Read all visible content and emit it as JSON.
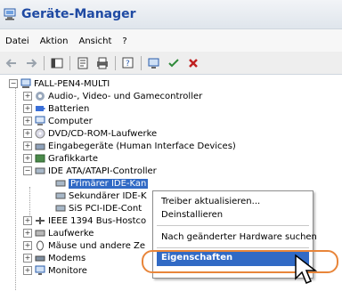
{
  "window": {
    "title": "Geräte-Manager"
  },
  "menu": [
    "Datei",
    "Aktion",
    "Ansicht",
    "?"
  ],
  "toolbar_icons": [
    "back-arrow-icon",
    "forward-arrow-icon",
    "show-hide-tree-icon",
    "properties-icon",
    "print-icon",
    "help-icon",
    "scan-hardware-icon",
    "update-driver-icon",
    "uninstall-icon"
  ],
  "tree": {
    "root": "FALL-PEN4-MULTI",
    "categories": [
      "Audio-, Video- und Gamecontroller",
      "Batterien",
      "Computer",
      "DVD/CD-ROM-Laufwerke",
      "Eingabegeräte (Human Interface Devices)",
      "Grafikkarte",
      "IDE ATA/ATAPI-Controller",
      "IEEE 1394 Bus-Hostco",
      "Laufwerke",
      "Mäuse und andere Ze",
      "Modems",
      "Monitore"
    ],
    "ide_children": [
      "Primärer IDE-Kan",
      "Sekundärer IDE-K",
      "SiS PCI-IDE-Cont"
    ]
  },
  "context_menu": {
    "items": [
      "Treiber aktualisieren...",
      "Deinstallieren",
      "Nach geänderter Hardware suchen",
      "Eigenschaften"
    ],
    "highlighted": "Eigenschaften"
  },
  "colors": {
    "selection": "#316ac5",
    "title": "#1f4aa3",
    "highlight_ring": "#e8853a"
  }
}
